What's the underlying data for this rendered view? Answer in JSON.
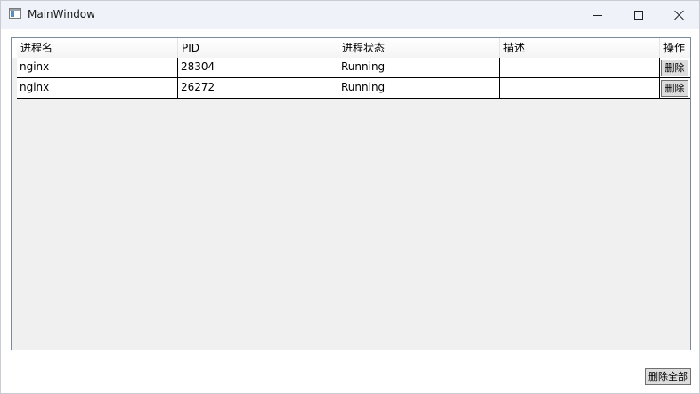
{
  "window": {
    "title": "MainWindow",
    "icon": "app-window-icon",
    "controls": [
      "minimize-icon",
      "maximize-icon",
      "close-icon"
    ]
  },
  "table": {
    "columns": [
      "进程名",
      "PID",
      "进程状态",
      "描述",
      "操作"
    ],
    "rows": [
      {
        "name": "nginx",
        "pid": "28304",
        "status": "Running",
        "description": "",
        "action": "删除"
      },
      {
        "name": "nginx",
        "pid": "26272",
        "status": "Running",
        "description": "",
        "action": "删除"
      }
    ]
  },
  "footer": {
    "delete_all_label": "删除全部"
  }
}
